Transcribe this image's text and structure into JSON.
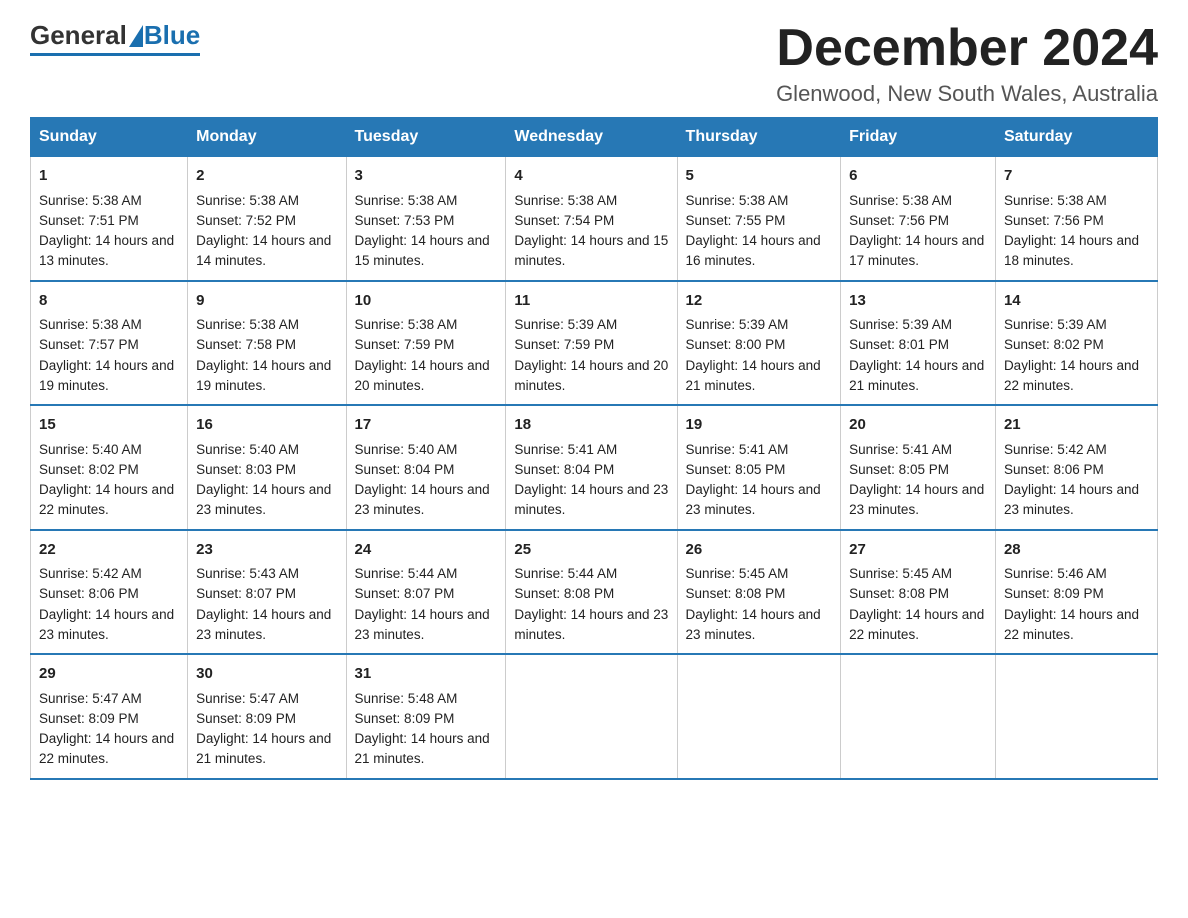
{
  "header": {
    "logo_general": "General",
    "logo_blue": "Blue",
    "month_title": "December 2024",
    "location": "Glenwood, New South Wales, Australia"
  },
  "weekdays": [
    "Sunday",
    "Monday",
    "Tuesday",
    "Wednesday",
    "Thursday",
    "Friday",
    "Saturday"
  ],
  "weeks": [
    [
      {
        "day": "1",
        "sunrise": "5:38 AM",
        "sunset": "7:51 PM",
        "daylight": "14 hours and 13 minutes."
      },
      {
        "day": "2",
        "sunrise": "5:38 AM",
        "sunset": "7:52 PM",
        "daylight": "14 hours and 14 minutes."
      },
      {
        "day": "3",
        "sunrise": "5:38 AM",
        "sunset": "7:53 PM",
        "daylight": "14 hours and 15 minutes."
      },
      {
        "day": "4",
        "sunrise": "5:38 AM",
        "sunset": "7:54 PM",
        "daylight": "14 hours and 15 minutes."
      },
      {
        "day": "5",
        "sunrise": "5:38 AM",
        "sunset": "7:55 PM",
        "daylight": "14 hours and 16 minutes."
      },
      {
        "day": "6",
        "sunrise": "5:38 AM",
        "sunset": "7:56 PM",
        "daylight": "14 hours and 17 minutes."
      },
      {
        "day": "7",
        "sunrise": "5:38 AM",
        "sunset": "7:56 PM",
        "daylight": "14 hours and 18 minutes."
      }
    ],
    [
      {
        "day": "8",
        "sunrise": "5:38 AM",
        "sunset": "7:57 PM",
        "daylight": "14 hours and 19 minutes."
      },
      {
        "day": "9",
        "sunrise": "5:38 AM",
        "sunset": "7:58 PM",
        "daylight": "14 hours and 19 minutes."
      },
      {
        "day": "10",
        "sunrise": "5:38 AM",
        "sunset": "7:59 PM",
        "daylight": "14 hours and 20 minutes."
      },
      {
        "day": "11",
        "sunrise": "5:39 AM",
        "sunset": "7:59 PM",
        "daylight": "14 hours and 20 minutes."
      },
      {
        "day": "12",
        "sunrise": "5:39 AM",
        "sunset": "8:00 PM",
        "daylight": "14 hours and 21 minutes."
      },
      {
        "day": "13",
        "sunrise": "5:39 AM",
        "sunset": "8:01 PM",
        "daylight": "14 hours and 21 minutes."
      },
      {
        "day": "14",
        "sunrise": "5:39 AM",
        "sunset": "8:02 PM",
        "daylight": "14 hours and 22 minutes."
      }
    ],
    [
      {
        "day": "15",
        "sunrise": "5:40 AM",
        "sunset": "8:02 PM",
        "daylight": "14 hours and 22 minutes."
      },
      {
        "day": "16",
        "sunrise": "5:40 AM",
        "sunset": "8:03 PM",
        "daylight": "14 hours and 23 minutes."
      },
      {
        "day": "17",
        "sunrise": "5:40 AM",
        "sunset": "8:04 PM",
        "daylight": "14 hours and 23 minutes."
      },
      {
        "day": "18",
        "sunrise": "5:41 AM",
        "sunset": "8:04 PM",
        "daylight": "14 hours and 23 minutes."
      },
      {
        "day": "19",
        "sunrise": "5:41 AM",
        "sunset": "8:05 PM",
        "daylight": "14 hours and 23 minutes."
      },
      {
        "day": "20",
        "sunrise": "5:41 AM",
        "sunset": "8:05 PM",
        "daylight": "14 hours and 23 minutes."
      },
      {
        "day": "21",
        "sunrise": "5:42 AM",
        "sunset": "8:06 PM",
        "daylight": "14 hours and 23 minutes."
      }
    ],
    [
      {
        "day": "22",
        "sunrise": "5:42 AM",
        "sunset": "8:06 PM",
        "daylight": "14 hours and 23 minutes."
      },
      {
        "day": "23",
        "sunrise": "5:43 AM",
        "sunset": "8:07 PM",
        "daylight": "14 hours and 23 minutes."
      },
      {
        "day": "24",
        "sunrise": "5:44 AM",
        "sunset": "8:07 PM",
        "daylight": "14 hours and 23 minutes."
      },
      {
        "day": "25",
        "sunrise": "5:44 AM",
        "sunset": "8:08 PM",
        "daylight": "14 hours and 23 minutes."
      },
      {
        "day": "26",
        "sunrise": "5:45 AM",
        "sunset": "8:08 PM",
        "daylight": "14 hours and 23 minutes."
      },
      {
        "day": "27",
        "sunrise": "5:45 AM",
        "sunset": "8:08 PM",
        "daylight": "14 hours and 22 minutes."
      },
      {
        "day": "28",
        "sunrise": "5:46 AM",
        "sunset": "8:09 PM",
        "daylight": "14 hours and 22 minutes."
      }
    ],
    [
      {
        "day": "29",
        "sunrise": "5:47 AM",
        "sunset": "8:09 PM",
        "daylight": "14 hours and 22 minutes."
      },
      {
        "day": "30",
        "sunrise": "5:47 AM",
        "sunset": "8:09 PM",
        "daylight": "14 hours and 21 minutes."
      },
      {
        "day": "31",
        "sunrise": "5:48 AM",
        "sunset": "8:09 PM",
        "daylight": "14 hours and 21 minutes."
      },
      null,
      null,
      null,
      null
    ]
  ]
}
